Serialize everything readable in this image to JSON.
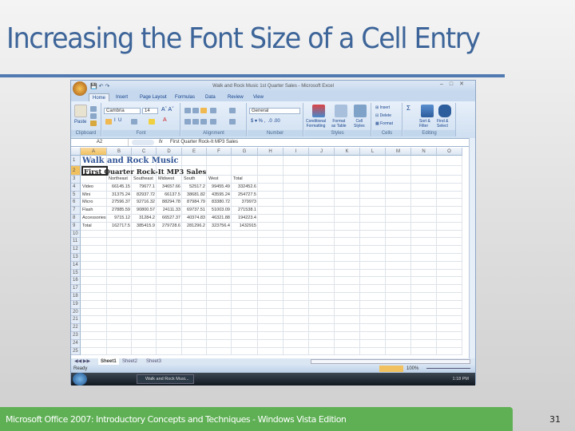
{
  "slide": {
    "title": "Increasing the Font Size of a Cell Entry",
    "footer": "Microsoft Office 2007: Introductory Concepts and Techniques - Windows Vista Edition",
    "page_number": "31"
  },
  "window": {
    "title": "Walk and Rock Music 1st Quarter Sales - Microsoft Excel"
  },
  "tabs": [
    "Home",
    "Insert",
    "Page Layout",
    "Formulas",
    "Data",
    "Review",
    "View"
  ],
  "ribbon": {
    "paste": "Paste",
    "font_name": "Cambria",
    "font_size": "14",
    "number_format": "General",
    "conditional": "Conditional",
    "conditional2": "Formatting",
    "format_table": "Format",
    "format_table2": "as Table",
    "cell_styles": "Cell",
    "cell_styles2": "Styles",
    "insert": "Insert",
    "delete": "Delete",
    "format": "Format",
    "sort": "Sort &",
    "sort2": "Filter",
    "find": "Find &",
    "find2": "Select",
    "groups": [
      "Clipboard",
      "Font",
      "Alignment",
      "Number",
      "Styles",
      "Cells",
      "Editing"
    ]
  },
  "formula_bar": {
    "name_box": "A2",
    "fx": "fx",
    "content": "First Quarter Rock-It MP3 Sales"
  },
  "columns": [
    "A",
    "B",
    "C",
    "D",
    "E",
    "F",
    "G",
    "H",
    "I",
    "J",
    "K",
    "L",
    "M",
    "N",
    "O"
  ],
  "sheet": {
    "title": "Walk and Rock Music",
    "subtitle": "First Quarter Rock-It MP3 Sales",
    "headers": [
      "",
      "Northeast",
      "Southeast",
      "Midwest",
      "South",
      "West",
      "Total"
    ],
    "rows": [
      [
        "Video",
        "66145.15",
        "79677.1",
        "34657.66",
        "52517.2",
        "99455.49",
        "332452.6"
      ],
      [
        "Mini",
        "31375.24",
        "82937.72",
        "66137.5",
        "38681.82",
        "43595.24",
        "254727.5"
      ],
      [
        "Micro",
        "27596.37",
        "92716.32",
        "88294.78",
        "87984.79",
        "83380.72",
        "379973"
      ],
      [
        "Flash",
        "27885.59",
        "90800.57",
        "24111.33",
        "69737.51",
        "51003.09",
        "271538.1"
      ],
      [
        "Accessories",
        "9715.12",
        "31284.2",
        "66527.37",
        "40374.83",
        "46321.88",
        "194223.4"
      ],
      [
        "Total",
        "162717.5",
        "385415.9",
        "279728.6",
        "281296.2",
        "323756.4",
        "1432915"
      ]
    ]
  },
  "sheet_tabs": [
    "Sheet1",
    "Sheet2",
    "Sheet3"
  ],
  "status": {
    "ready": "Ready",
    "zoom": "100%"
  },
  "taskbar": {
    "app": "Walk and Rock Musi...",
    "time": "1:18 PM"
  }
}
